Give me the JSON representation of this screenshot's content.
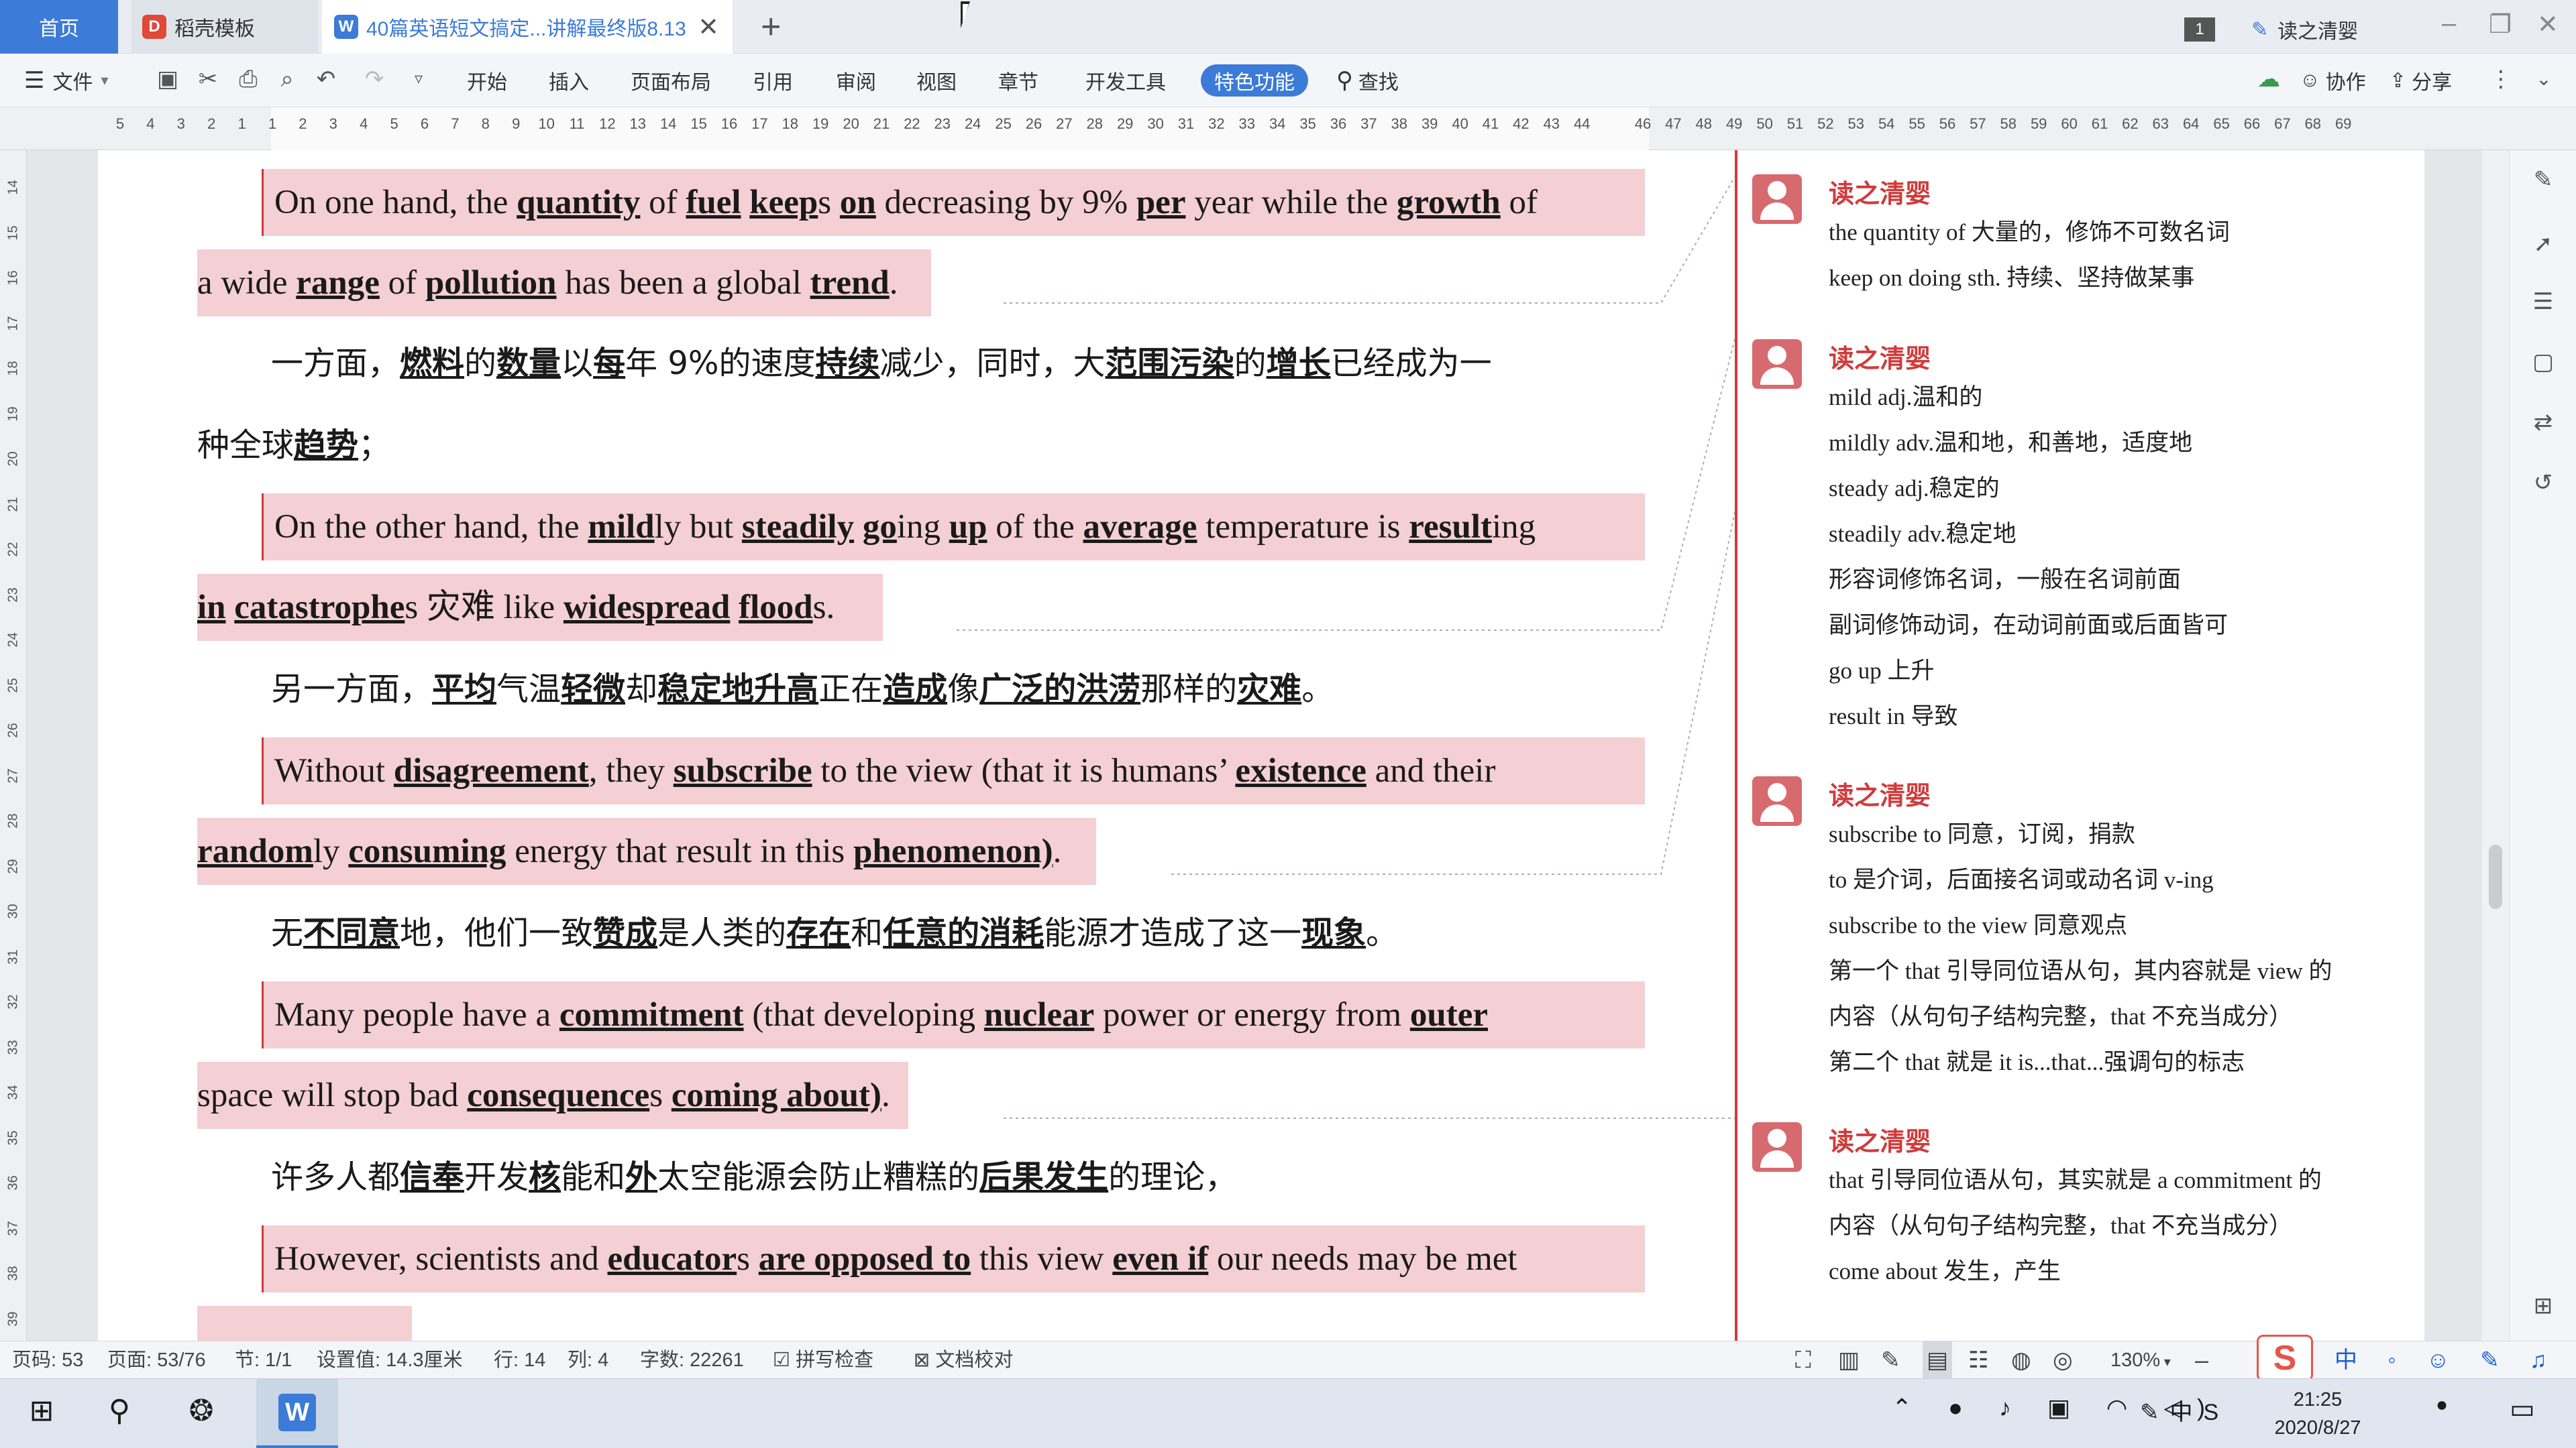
{
  "tabs": {
    "home": "首页",
    "template": "稻壳模板",
    "document": "40篇英语短文搞定...讲解最终版8.13",
    "window_count": "1",
    "user": "读之清婴"
  },
  "ribbon": {
    "file": "文件",
    "items": [
      "开始",
      "插入",
      "页面布局",
      "引用",
      "审阅",
      "视图",
      "章节",
      "开发工具"
    ],
    "active": "特色功能",
    "search": "查找",
    "collaborate": "协作",
    "share": "分享"
  },
  "ruler": {
    "marks": [
      "5",
      "4",
      "3",
      "2",
      "1",
      "1",
      "2",
      "3",
      "4",
      "5",
      "6",
      "7",
      "8",
      "9",
      "10",
      "11",
      "12",
      "13",
      "14",
      "15",
      "16",
      "17",
      "18",
      "19",
      "20",
      "21",
      "22",
      "23",
      "24",
      "25",
      "26",
      "27",
      "28",
      "29",
      "30",
      "31",
      "32",
      "33",
      "34",
      "35",
      "36",
      "37",
      "38",
      "39",
      "40",
      "41",
      "42",
      "43",
      "44",
      "46",
      "47",
      "48",
      "49",
      "50",
      "51",
      "52",
      "53",
      "54",
      "55",
      "56",
      "57",
      "58",
      "59",
      "60",
      "61",
      "62",
      "63",
      "64",
      "65",
      "66",
      "67",
      "68",
      "69"
    ],
    "vmarks": [
      "14",
      "15",
      "16",
      "17",
      "18",
      "19",
      "20",
      "21",
      "22",
      "23",
      "24",
      "25",
      "26",
      "27",
      "28",
      "29",
      "30",
      "31",
      "32",
      "33",
      "34",
      "35",
      "36",
      "37",
      "38",
      "39"
    ]
  },
  "document": {
    "p1_l1": {
      "a": "On one hand, the ",
      "b1": "quantity",
      "c": " of ",
      "b2": "fuel",
      "d": " ",
      "b3": "keep",
      "e": "s ",
      "b4": "on",
      "f": " decreasing by 9% ",
      "b5": "per",
      "g": " year while the ",
      "b6": "growth",
      "h": " of"
    },
    "p1_l2": {
      "a": "a wide ",
      "b1": "range",
      "c": " of ",
      "b2": "pollution",
      "d": " has been a global ",
      "b3": "trend",
      "e": "."
    },
    "c1_l1": {
      "a": "一方面，",
      "b1": "燃料",
      "c": "的",
      "b2": "数量",
      "d": "以",
      "b3": "每",
      "e": "年 9%的速度",
      "b4": "持续",
      "f": "减少，同时，大",
      "b5": "范围污染",
      "g": "的",
      "b6": "增长",
      "h": "已经成为一"
    },
    "c1_l2": {
      "a": "种全球",
      "b1": "趋势",
      "c": "；"
    },
    "p2_l1": {
      "a": "On the other hand, the ",
      "b1": "mild",
      "c": "ly but ",
      "b2": "steadily",
      "d": " ",
      "b3": "go",
      "e": "ing ",
      "b4": "up",
      "f": " of the ",
      "b5": "average",
      "g": " temperature is ",
      "b6": "result",
      "h": "ing"
    },
    "p2_l2": {
      "b1": "in",
      "a": " ",
      "b2": "catastrophe",
      "c": "s  灾难  like ",
      "b3": "widespread",
      "d": " ",
      "b4": "flood",
      "e": "s."
    },
    "c2_l1": {
      "a": "另一方面，",
      "b1": "平均",
      "c": "气温",
      "b2": "轻微",
      "d": "却",
      "b3": "稳定地升高",
      "e": "正在",
      "b4": "造成",
      "f": "像",
      "b5": "广泛的洪涝",
      "g": "那样的",
      "b6": "灾难",
      "h": "。"
    },
    "p3_l1": {
      "a": "Without ",
      "b1": "disagreement",
      "c": ", they ",
      "b2": "subscribe",
      "d": " to the view (that it is humans’ ",
      "b3": "existence",
      "e": " and their"
    },
    "p3_l2": {
      "b1": "random",
      "a": "ly ",
      "b2": "consuming",
      "c": " energy that result in this ",
      "b3": "phenomenon)",
      "d": "."
    },
    "c3_l1": {
      "a": "无",
      "b1": "不同意",
      "c": "地，他们一致",
      "b2": "赞成",
      "d": "是人类的",
      "b3": "存在",
      "e": "和",
      "b4": "任意的消耗",
      "f": "能源才造成了这一",
      "b5": "现象",
      "g": "。"
    },
    "p4_l1": {
      "a": "Many people have a ",
      "b1": "commitment",
      "c": " (that developing ",
      "b2": "nuclear",
      "d": " power or energy from ",
      "b3": "outer"
    },
    "p4_l2": {
      "a": "space will stop bad ",
      "b1": "consequence",
      "c": "s ",
      "b2": "coming about)",
      "d": "."
    },
    "c4_l1": {
      "a": "许多人都",
      "b1": "信奉",
      "c": "开发",
      "b2": "核",
      "d": "能和",
      "b3": "外",
      "e": "太空能源会防止糟糕的",
      "b4": "后果发生",
      "f": "的理论，"
    },
    "p5_l1": {
      "a": "However, scientists and ",
      "b1": "educator",
      "c": "s ",
      "b2": "are opposed to",
      "d": " this view ",
      "b3": "even if",
      "e": " our needs may be met"
    }
  },
  "comments": [
    {
      "author": "读之清婴",
      "lines": [
        "the quantity of 大量的，修饰不可数名词",
        "keep on doing sth.   持续、坚持做某事"
      ]
    },
    {
      "author": "读之清婴",
      "lines": [
        "mild    adj.温和的",
        "mildly    adv.温和地，和善地，适度地",
        "steady    adj.稳定的",
        "steadily    adv.稳定地",
        "形容词修饰名词，一般在名词前面",
        "副词修饰动词，在动词前面或后面皆可",
        "go up  上升",
        "result in  导致"
      ]
    },
    {
      "author": "读之清婴",
      "lines": [
        "subscribe to  同意，订阅，捐款",
        "to 是介词，后面接名词或动名词 v-ing",
        "subscribe to the view  同意观点",
        "第一个 that 引导同位语从句，其内容就是 view 的",
        "内容（从句句子结构完整，that 不充当成分）",
        "第二个 that 就是 it is...that...强调句的标志"
      ]
    },
    {
      "author": "读之清婴",
      "lines": [
        "that 引导同位语从句，其实就是 a commitment 的",
        "内容（从句句子结构完整，that 不充当成分）",
        "come about  发生，产生"
      ]
    }
  ],
  "status": {
    "page_code": "页码: 53",
    "pages": "页面: 53/76",
    "section": "节: 1/1",
    "setting": "设置值: 14.3厘米",
    "row": "行: 14",
    "col": "列: 4",
    "words": "字数: 22261",
    "spell": "拼写检查",
    "proof": "文档校对",
    "zoom": "130%"
  },
  "taskbar": {
    "time": "21:25",
    "date": "2020/8/27",
    "ime": "中"
  },
  "colors": {
    "accent": "#3c7bd7",
    "highlight": "#f4cfd3",
    "comment_red": "#cf3b3b"
  }
}
